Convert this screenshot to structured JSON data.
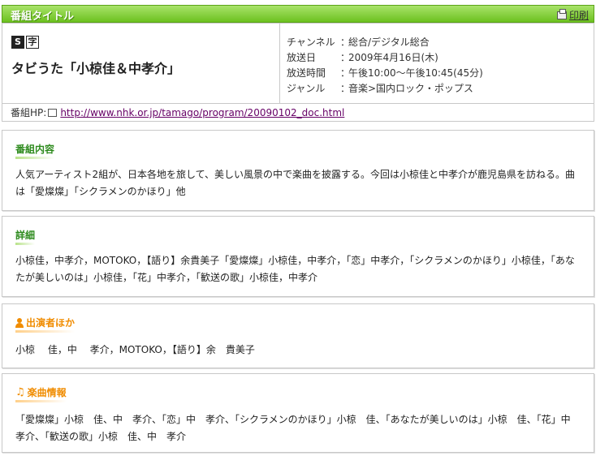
{
  "header": {
    "title": "番組タイトル",
    "print_label": "印刷"
  },
  "program": {
    "badges": [
      "S",
      "字"
    ],
    "title": "タビうた「小椋佳＆中孝介」",
    "info": [
      {
        "key": "チャンネル",
        "value": "総合/デジタル総合"
      },
      {
        "key": "放送日",
        "value": "2009年4月16日(木)"
      },
      {
        "key": "放送時間",
        "value": "午後10:00～午後10:45(45分)"
      },
      {
        "key": "ジャンル",
        "value": "音楽>国内ロック・ポップス"
      }
    ],
    "hp_label": "番組HP:",
    "hp_url": "http://www.nhk.or.jp/tamago/program/20090102_doc.html"
  },
  "sections": {
    "content": {
      "heading": "番組内容",
      "body": "人気アーティスト2組が、日本各地を旅して、美しい風景の中で楽曲を披露する。今回は小椋佳と中孝介が鹿児島県を訪ねる。曲は「愛燦燦」「シクラメンのかほり」他"
    },
    "details": {
      "heading": "詳細",
      "body": "小椋佳，中孝介，MOTOKO，【語り】余貴美子「愛燦燦」小椋佳，中孝介，「恋」中孝介，「シクラメンのかほり」小椋佳，「あなたが美しいのは」小椋佳，「花」中孝介，「歓送の歌」小椋佳，中孝介"
    },
    "cast": {
      "heading": "出演者ほか",
      "body": "小椋　 佳，中　 孝介，MOTOKO，【語り】余　貴美子"
    },
    "music": {
      "heading": "楽曲情報",
      "body": "「愛燦燦」小椋　佳、中　孝介、「恋」中　孝介、「シクラメンのかほり」小椋　佳、「あなたが美しいのは」小椋　佳、「花」中　孝介、「歓送の歌」小椋　佳、中　孝介"
    }
  },
  "colors": {
    "title_bar": "#6cc11f",
    "heading_green": "#2e8b1e",
    "heading_orange": "#f08c00",
    "link": "#660066"
  }
}
